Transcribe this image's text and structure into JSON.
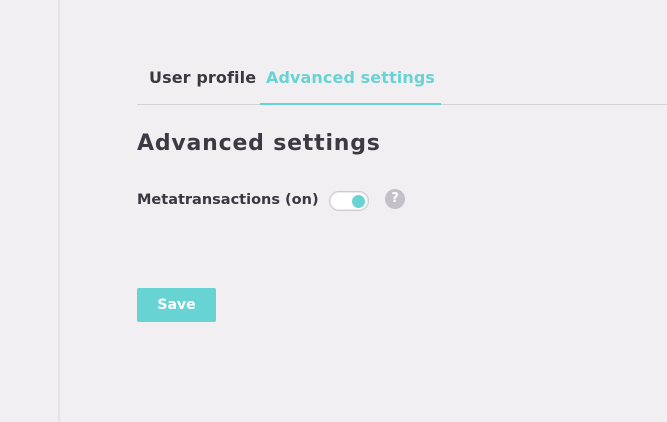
{
  "tabs": [
    {
      "label": "User profile",
      "active": false
    },
    {
      "label": "Advanced settings",
      "active": true
    }
  ],
  "section": {
    "title": "Advanced settings"
  },
  "settings": {
    "metatransactions": {
      "label": "Metatransactions (on)",
      "enabled": true,
      "help_icon": "question-mark-icon",
      "help_glyph": "?"
    }
  },
  "actions": {
    "save_label": "Save"
  },
  "colors": {
    "accent": "#68d3d3",
    "background": "#f2eff3",
    "text": "#3b3841",
    "help_icon": "#c4c0c8"
  }
}
